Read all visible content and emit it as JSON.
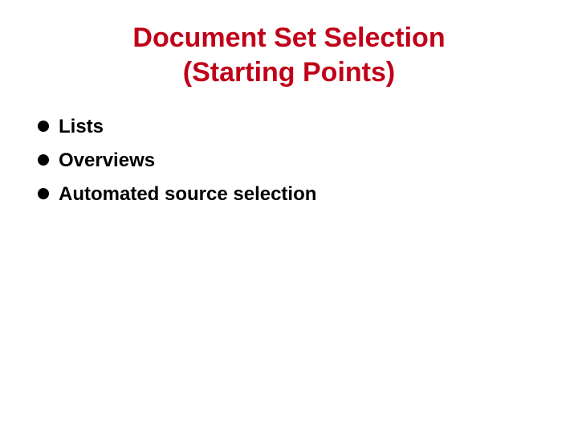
{
  "slide": {
    "title_line1": "Document Set Selection",
    "title_line2": "(Starting Points)",
    "bullets": [
      {
        "text": "Lists"
      },
      {
        "text": "Overviews"
      },
      {
        "text": "Automated source selection"
      }
    ]
  }
}
